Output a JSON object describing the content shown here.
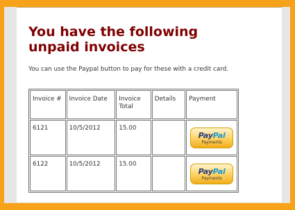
{
  "page": {
    "title": "You have the following unpaid invoices",
    "intro": "You can use the Paypal button to pay for these with a credit card."
  },
  "table": {
    "headers": {
      "invoice_number": "Invoice #",
      "invoice_date": "Invoice Date",
      "invoice_total": "Invoice Total",
      "details": "Details",
      "payment": "Payment"
    },
    "rows": [
      {
        "invoice_number": "6121",
        "invoice_date": "10/5/2012",
        "invoice_total": "15.00",
        "details": "",
        "payment_button": {
          "brand_part1": "Pay",
          "brand_part2": "Pal",
          "sub_label": "Payments"
        }
      },
      {
        "invoice_number": "6122",
        "invoice_date": "10/5/2012",
        "invoice_total": "15.00",
        "details": "",
        "payment_button": {
          "brand_part1": "Pay",
          "brand_part2": "Pal",
          "sub_label": "Payments"
        }
      }
    ]
  },
  "colors": {
    "background": "#f7a21b",
    "title": "#7f0000",
    "paypal_blue_dark": "#253b80",
    "paypal_blue_light": "#169bd7"
  }
}
